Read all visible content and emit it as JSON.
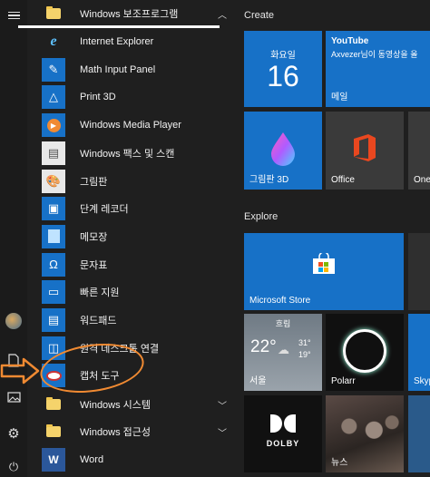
{
  "applist": {
    "folder_top": "Windows 보조프로그램",
    "items": [
      {
        "label": "Internet Explorer",
        "icon": "internet-explorer-icon"
      },
      {
        "label": "Math Input Panel",
        "icon": "math-input-panel-icon"
      },
      {
        "label": "Print 3D",
        "icon": "print-3d-icon"
      },
      {
        "label": "Windows Media Player",
        "icon": "media-player-icon"
      },
      {
        "label": "Windows 팩스 및 스캔",
        "icon": "fax-scan-icon"
      },
      {
        "label": "그림판",
        "icon": "paint-icon"
      },
      {
        "label": "단계 레코더",
        "icon": "steps-recorder-icon"
      },
      {
        "label": "메모장",
        "icon": "notepad-icon"
      },
      {
        "label": "문자표",
        "icon": "character-map-icon"
      },
      {
        "label": "빠른 지원",
        "icon": "quick-assist-icon"
      },
      {
        "label": "워드패드",
        "icon": "wordpad-icon"
      },
      {
        "label": "원격 데스크톱 연결",
        "icon": "remote-desktop-icon"
      },
      {
        "label": "캡처 도구",
        "icon": "snipping-tool-icon"
      }
    ],
    "folder_system": "Windows 시스템",
    "folder_access": "Windows 접근성",
    "word": "Word"
  },
  "tiles": {
    "group_create": "Create",
    "group_explore": "Explore",
    "calendar": {
      "day": "화요일",
      "date": "16"
    },
    "youtube": {
      "title": "YouTube",
      "subtitle": "Axvezer님이 동영상을 올",
      "footer": "메일"
    },
    "paint3d": "그림판 3D",
    "office": "Office",
    "onenote": "One",
    "store": "Microsoft Store",
    "weather": {
      "cond": "흐림",
      "temp": "22°",
      "high": "31°",
      "low": "19°",
      "city": "서울"
    },
    "polarr": "Polarr",
    "skype": "Skyp",
    "dolby": "DOLBY",
    "news": "뉴스"
  },
  "colors": {
    "accent": "#1771c7",
    "annotation": "#f08a32"
  }
}
